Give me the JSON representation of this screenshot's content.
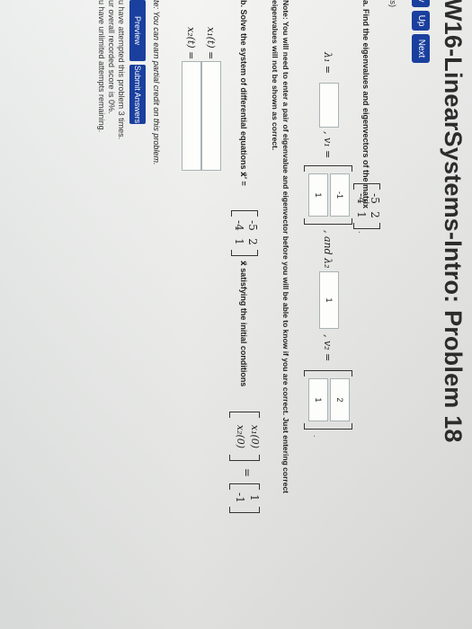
{
  "header": {
    "title": "W16-LinearSystems-Intro: Problem 18",
    "nav_prev": "v",
    "nav_up": "Up",
    "nav_next": "Next"
  },
  "points": "ts)",
  "part_a": {
    "prompt": "a. Find the eigenvalues and eigenvectors of the matrix",
    "matrix": [
      "-5",
      "2",
      "-4",
      "1"
    ],
    "lambda1_label": "λ₁ =",
    "lambda1_value": "",
    "v1_label": ", v₁ =",
    "v1_values": [
      "-1",
      "1"
    ],
    "and_lambda2_label": ", and λ₂ =",
    "lambda2_value": "1",
    "v2_label": ", v₂ =",
    "v2_values": [
      "2",
      "1"
    ],
    "period": "."
  },
  "note": {
    "line1": "Note: You will need to enter a pair of eigenvalue and eigenvector before you will be able to know if you are correct. Just entering correct",
    "line2": "eigenvalues will not be shown as correct."
  },
  "part_b": {
    "prompt": "b. Solve the system of differential equations x⃗′ =",
    "matrix": [
      "-5",
      "2",
      "-4",
      "1"
    ],
    "after_matrix": "x⃗ satisfying the initial conditions",
    "init_left": [
      "x₁(0)",
      "x₂(0)"
    ],
    "equals": "=",
    "init_right": [
      "1",
      "-1"
    ],
    "x1_label": "x₁(t) =",
    "x1_value": "",
    "x2_label": "x₂(t) =",
    "x2_value": ""
  },
  "footer": {
    "credit_note": "te: You can earn partial credit on this problem.",
    "preview_button": "Preview Answers",
    "submit_button": "Submit Answers",
    "attempt_line1": "u have attempted this problem 3 times.",
    "attempt_line2": "ur overall recorded score is 0%.",
    "attempt_line3": "u have unlimited attempts remaining."
  }
}
